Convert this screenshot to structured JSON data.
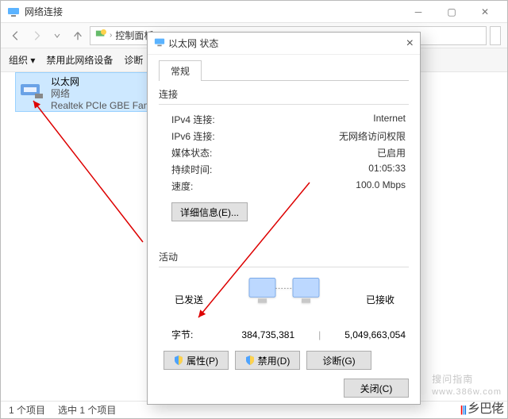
{
  "window": {
    "title": "网络连接",
    "breadcrumb": {
      "root": "控制面板",
      "a": "... "
    },
    "toolbar": {
      "organize": "组织 ▾",
      "disable": "禁用此网络设备",
      "diagnose": "诊断"
    },
    "status": {
      "count": "1 个项目",
      "selected": "选中 1 个项目"
    }
  },
  "adapter": {
    "name": "以太网",
    "net": "网络",
    "device": "Realtek PCIe GBE Family C"
  },
  "dialog": {
    "title": "以太网 状态",
    "tab": "常规",
    "section_conn": "连接",
    "rows": {
      "ipv4_k": "IPv4 连接:",
      "ipv4_v": "Internet",
      "ipv6_k": "IPv6 连接:",
      "ipv6_v": "无网络访问权限",
      "media_k": "媒体状态:",
      "media_v": "已启用",
      "dur_k": "持续时间:",
      "dur_v": "01:05:33",
      "speed_k": "速度:",
      "speed_v": "100.0 Mbps"
    },
    "details_btn": "详细信息(E)...",
    "section_act": "活动",
    "sent": "已发送",
    "recv": "已接收",
    "bytes_lbl": "字节:",
    "bytes_sent": "384,735,381",
    "bytes_recv": "5,049,663,054",
    "btn_props": "属性(P)",
    "btn_disable": "禁用(D)",
    "btn_diag": "诊断(G)",
    "btn_close": "关闭(C)"
  },
  "watermark": {
    "text": "搜问指南",
    "url": "www.386w.com"
  },
  "overlay_logo": {
    "text": "乡巴佬"
  }
}
